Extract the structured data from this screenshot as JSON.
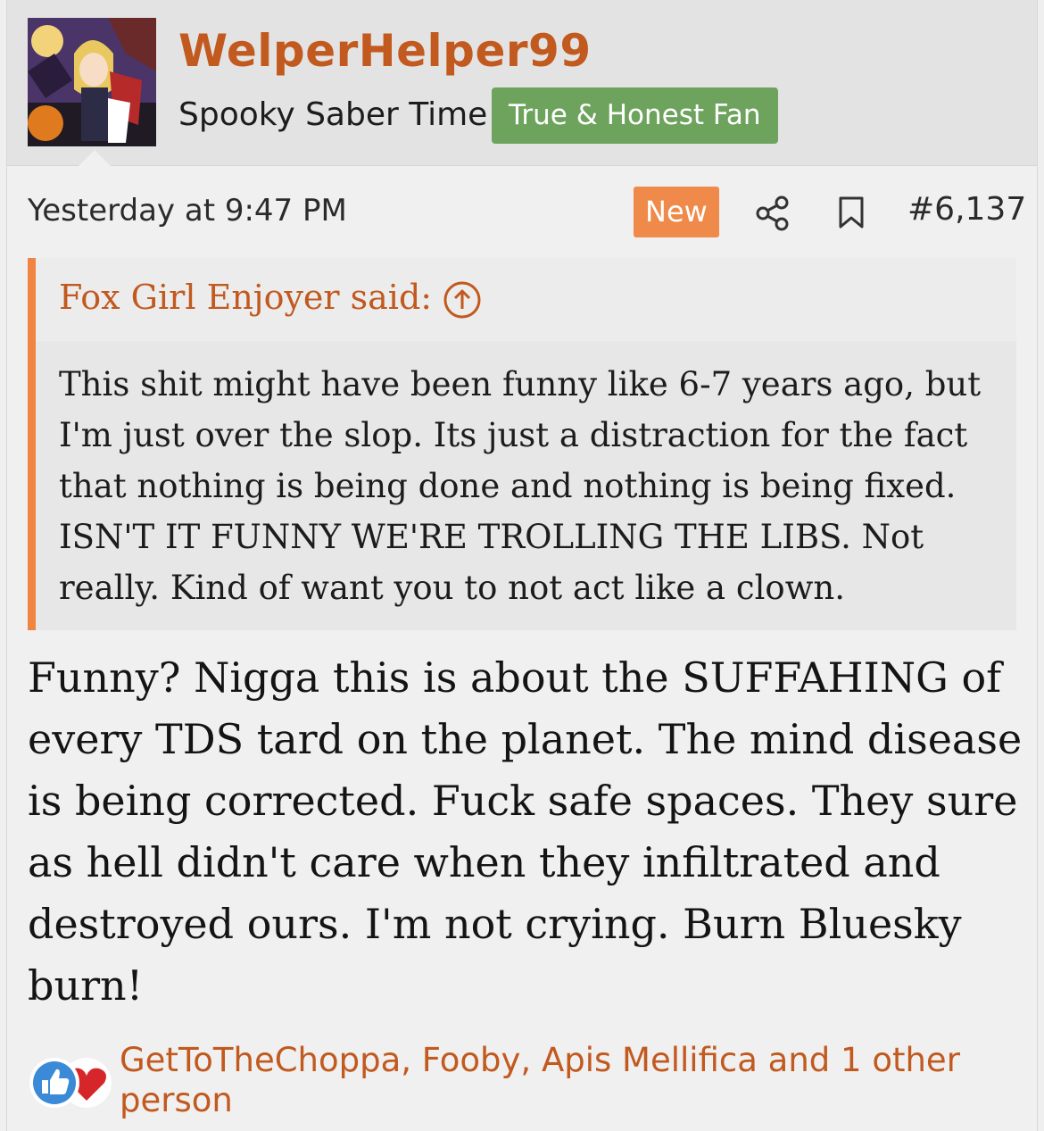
{
  "user": {
    "name": "WelperHelper99",
    "title": "Spooky Saber Time",
    "banner": "True & Honest Fan",
    "avatar_alt": "anime-avatar"
  },
  "post": {
    "date": "Yesterday at 9:47 PM",
    "badge": "New",
    "number": "#6,137",
    "icons": {
      "share": "share-icon",
      "bookmark": "bookmark-icon"
    }
  },
  "quote": {
    "author": "Fox Girl Enjoyer said:",
    "text": "This shit might have been funny like 6-7 years ago, but I'm just over the slop. Its just a distraction for the fact that nothing is being done and nothing is being fixed. ISN'T IT FUNNY WE'RE TROLLING THE LIBS. Not really. Kind of want you to not act like a clown."
  },
  "message": {
    "text": "Funny? Nigga this is about the SUFFAHING of every TDS tard on the planet. The mind disease is being corrected. Fuck safe spaces. They sure as hell didn't care when they infiltrated and destroyed ours. I'm not crying. Burn Bluesky burn!"
  },
  "reactions": {
    "text": "GetToTheChoppa, Fooby, Apis Mellifica and 1 other person",
    "icons": [
      "like-icon",
      "love-icon"
    ]
  },
  "colors": {
    "username": "#c2591e",
    "banner": "#6da35c",
    "new_badge": "#f08a4a",
    "quote_border": "#ef8540"
  }
}
